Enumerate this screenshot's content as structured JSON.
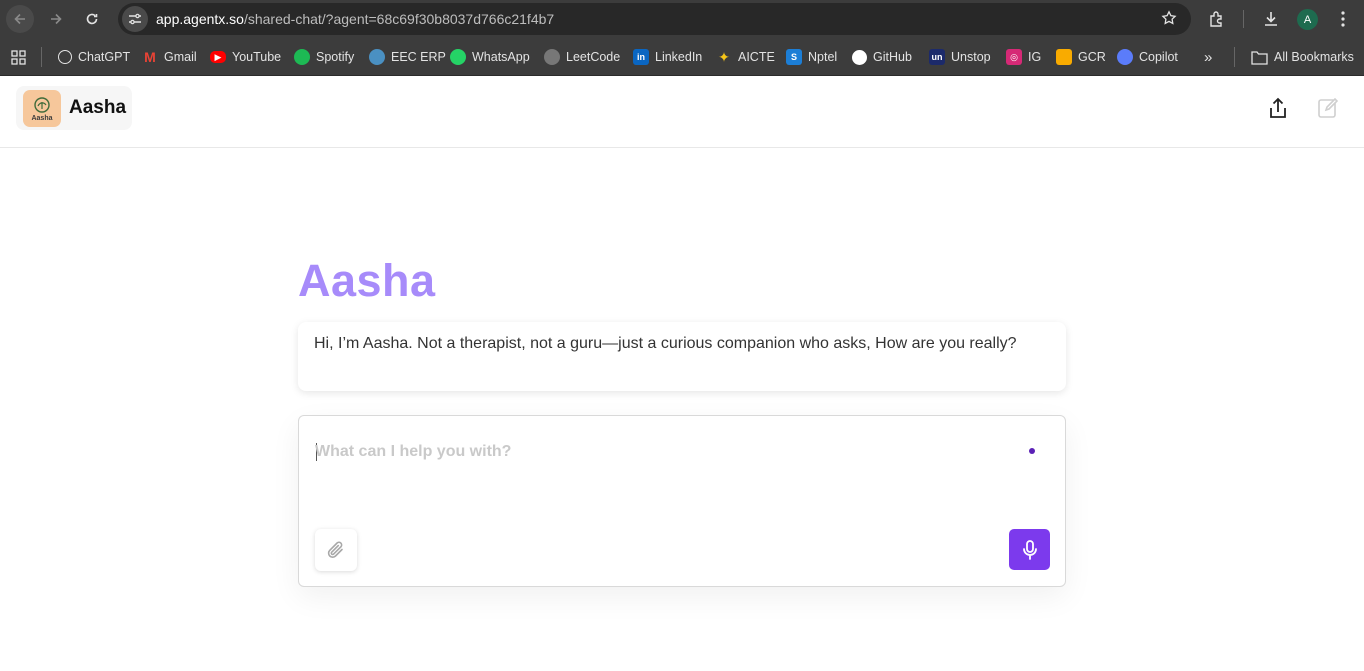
{
  "browser": {
    "url_host": "app.agentx.so",
    "url_path": "/shared-chat/?agent=68c69f30b8037d766c21f4b7",
    "avatar_letter": "A",
    "bookmarks": [
      {
        "label": "ChatGPT",
        "icon": "chatgpt-icon",
        "color": "#3c3c3c"
      },
      {
        "label": "Gmail",
        "icon": "gmail-icon",
        "color": "#ea4335"
      },
      {
        "label": "YouTube",
        "icon": "youtube-icon",
        "color": "#ff0000"
      },
      {
        "label": "Spotify",
        "icon": "spotify-icon",
        "color": "#1db954"
      },
      {
        "label": "EEC ERP",
        "icon": "erp-icon",
        "color": "#4a90c2"
      },
      {
        "label": "WhatsApp",
        "icon": "whatsapp-icon",
        "color": "#25d366"
      },
      {
        "label": "LeetCode",
        "icon": "globe-icon",
        "color": "#777777"
      },
      {
        "label": "LinkedIn",
        "icon": "linkedin-icon",
        "color": "#0a66c2"
      },
      {
        "label": "AICTE",
        "icon": "aicte-icon",
        "color": "#2f4fa0"
      },
      {
        "label": "Nptel",
        "icon": "nptel-icon",
        "color": "#1c7ed6"
      },
      {
        "label": "GitHub",
        "icon": "github-icon",
        "color": "#111111"
      },
      {
        "label": "Unstop",
        "icon": "unstop-icon",
        "color": "#1c2a6b"
      },
      {
        "label": "IG",
        "icon": "instagram-icon",
        "color": "#d62976"
      },
      {
        "label": "GCR",
        "icon": "classroom-icon",
        "color": "#f9ab00"
      },
      {
        "label": "Copilot",
        "icon": "copilot-icon",
        "color": "#5b7cfa"
      }
    ],
    "all_bookmarks_label": "All Bookmarks",
    "more_bookmarks": "»"
  },
  "app": {
    "agent_name": "Aasha",
    "logo_text": "Aasha",
    "logo_color": "#f6c79b"
  },
  "main": {
    "title": "Aasha",
    "title_color": "#a78bfa",
    "intro_message": "Hi, I’m Aasha. Not a therapist, not a guru—just a curious companion who asks, How are you really?",
    "composer_placeholder": "What can I help you with?",
    "composer_value": "",
    "accent_color": "#7c3aed"
  }
}
